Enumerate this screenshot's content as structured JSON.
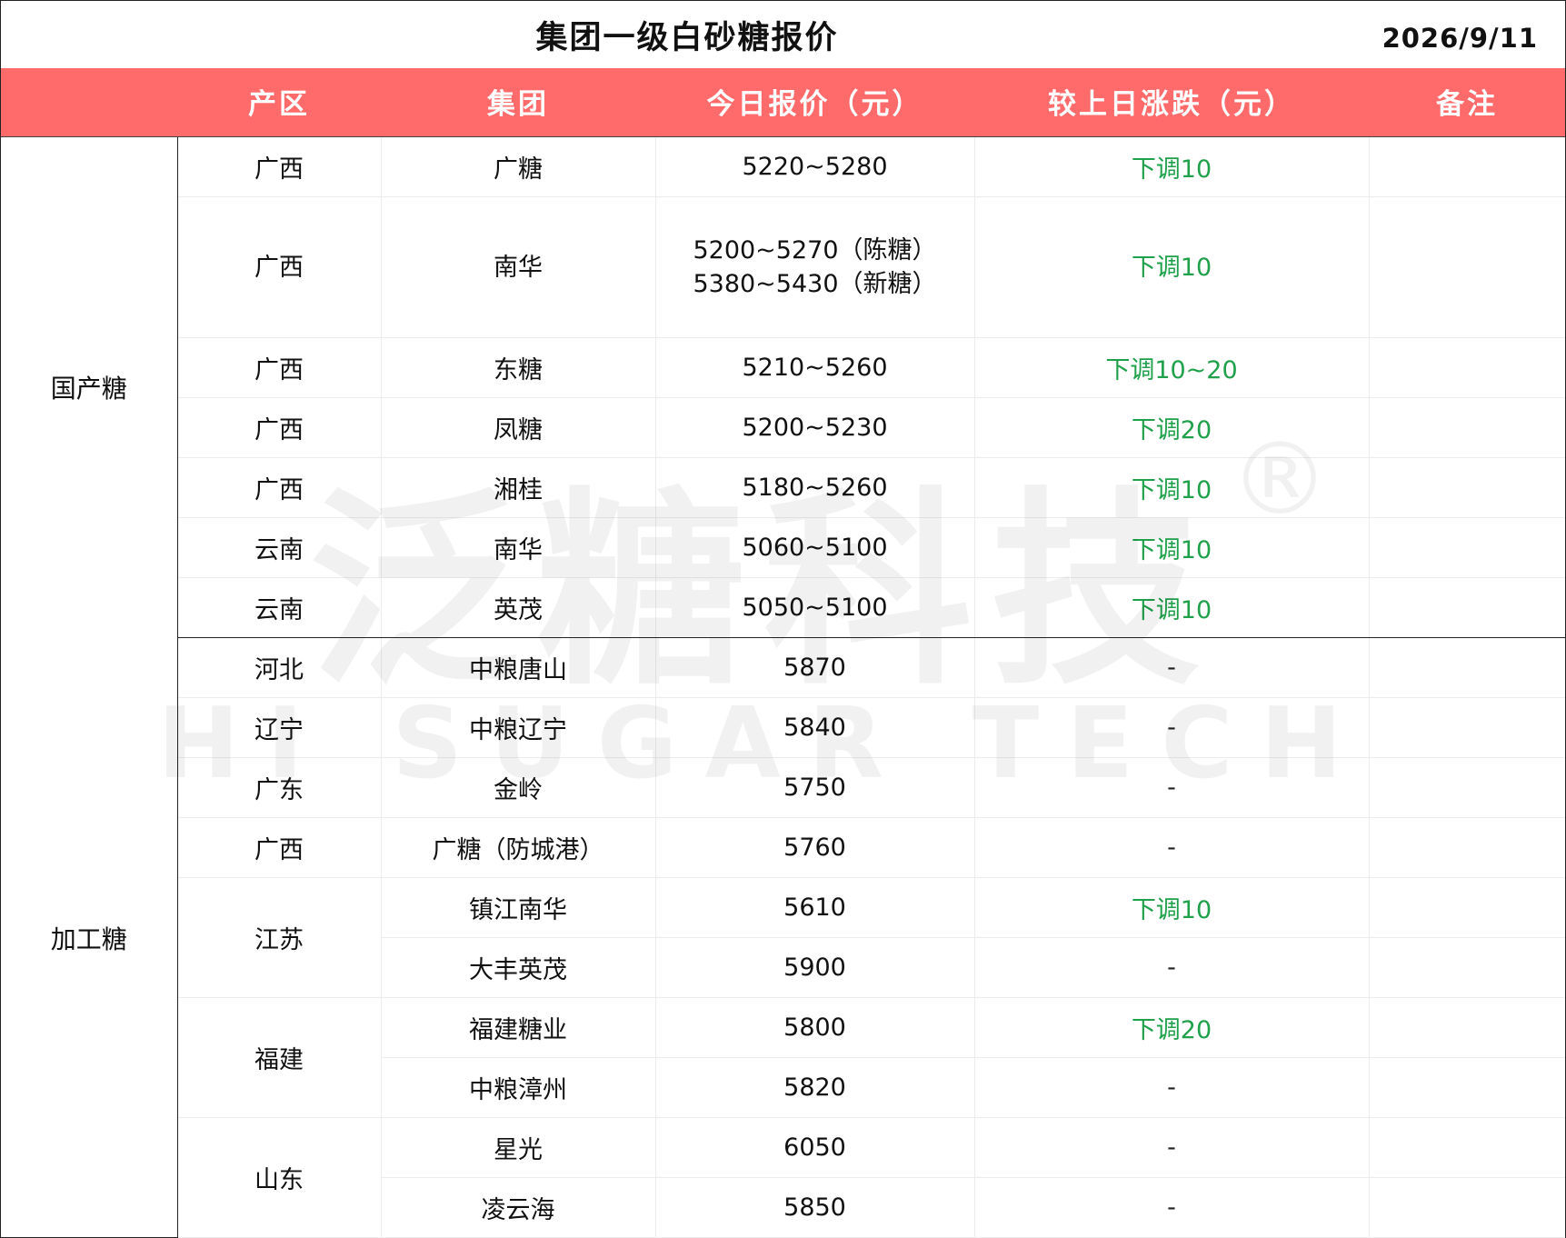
{
  "title": "集团一级白砂糖报价",
  "date": "2026/9/11",
  "watermark": {
    "cn": "泛糖科技",
    "en": "HI SUGAR TECH",
    "mark": "®"
  },
  "colors": {
    "header_bg": "#ff6b6b",
    "down_text": "#1fa04a",
    "header_text": "#ffffff"
  },
  "headers": [
    "产区",
    "集团",
    "今日报价（元）",
    "较上日涨跌（元）",
    "备注"
  ],
  "categories": {
    "domestic": "国产糖",
    "processed": "加工糖"
  },
  "rows": [
    {
      "region": "广西",
      "group": "广糖",
      "price": "5220~5280",
      "change": "下调10",
      "note": ""
    },
    {
      "region": "广西",
      "group": "南华",
      "price": "5200~5270（陈糖）",
      "price2": "5380~5430（新糖）",
      "change": "下调10",
      "note": ""
    },
    {
      "region": "广西",
      "group": "东糖",
      "price": "5210~5260",
      "change": "下调10~20",
      "note": ""
    },
    {
      "region": "广西",
      "group": "凤糖",
      "price": "5200~5230",
      "change": "下调20",
      "note": ""
    },
    {
      "region": "广西",
      "group": "湘桂",
      "price": "5180~5260",
      "change": "下调10",
      "note": ""
    },
    {
      "region": "云南",
      "group": "南华",
      "price": "5060~5100",
      "change": "下调10",
      "note": ""
    },
    {
      "region": "云南",
      "group": "英茂",
      "price": "5050~5100",
      "change": "下调10",
      "note": ""
    },
    {
      "region": "河北",
      "group": "中粮唐山",
      "price": "5870",
      "change": "-",
      "note": ""
    },
    {
      "region": "辽宁",
      "group": "中粮辽宁",
      "price": "5840",
      "change": "-",
      "note": ""
    },
    {
      "region": "广东",
      "group": "金岭",
      "price": "5750",
      "change": "-",
      "note": ""
    },
    {
      "region": "广西",
      "group": "广糖（防城港）",
      "price": "5760",
      "change": "-",
      "note": ""
    },
    {
      "region": "江苏",
      "group": "镇江南华",
      "price": "5610",
      "change": "下调10",
      "note": ""
    },
    {
      "region": "",
      "group": "大丰英茂",
      "price": "5900",
      "change": "-",
      "note": ""
    },
    {
      "region": "福建",
      "group": "福建糖业",
      "price": "5800",
      "change": "下调20",
      "note": ""
    },
    {
      "region": "",
      "group": "中粮漳州",
      "price": "5820",
      "change": "-",
      "note": ""
    },
    {
      "region": "山东",
      "group": "星光",
      "price": "6050",
      "change": "-",
      "note": ""
    },
    {
      "region": "",
      "group": "凌云海",
      "price": "5850",
      "change": "-",
      "note": ""
    }
  ]
}
